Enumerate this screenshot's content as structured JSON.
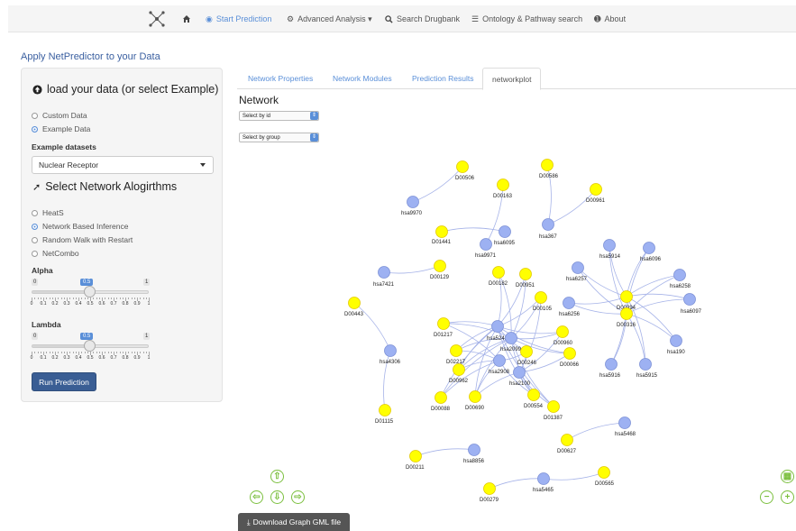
{
  "nav": {
    "items": [
      {
        "label": "",
        "icon": "network-logo-icon",
        "active": false
      },
      {
        "label": "",
        "icon": "home-icon",
        "active": false
      },
      {
        "label": "Start Prediction",
        "icon": "target-icon",
        "active": true
      },
      {
        "label": "Advanced Analysis ▾",
        "icon": "gears-icon",
        "active": false
      },
      {
        "label": "Search Drugbank",
        "icon": "search-icon",
        "active": false
      },
      {
        "label": "Ontology & Pathway search",
        "icon": "list-icon",
        "active": false
      },
      {
        "label": "About",
        "icon": "info-icon",
        "active": false
      }
    ]
  },
  "page": {
    "heading": "Apply NetPredictor to your Data"
  },
  "sidebar": {
    "load_title": "load your data (or select Example)",
    "data_options": [
      {
        "label": "Custom Data",
        "checked": false
      },
      {
        "label": "Example Data",
        "checked": true
      }
    ],
    "example_label": "Example datasets",
    "example_value": "Nuclear Receptor",
    "algo_title": "Select Network Alogirthms",
    "algo_options": [
      {
        "label": "HeatS",
        "checked": false
      },
      {
        "label": "Network Based Inference",
        "checked": true
      },
      {
        "label": "Random Walk with Restart",
        "checked": false
      },
      {
        "label": "NetCombo",
        "checked": false
      }
    ],
    "alpha": {
      "label": "Alpha",
      "min": "0",
      "max": "1",
      "value": "0.5",
      "fraction": 0.5
    },
    "lambda": {
      "label": "Lambda",
      "min": "0",
      "max": "1",
      "value": "0.5",
      "fraction": 0.5
    },
    "tick_labels": [
      "0",
      "0.1",
      "0.2",
      "0.3",
      "0.4",
      "0.5",
      "0.6",
      "0.7",
      "0.8",
      "0.9",
      "1"
    ],
    "run_label": "Run Prediction"
  },
  "tabs": [
    {
      "label": "Network Properties",
      "active": false
    },
    {
      "label": "Network Modules",
      "active": false
    },
    {
      "label": "Prediction Results",
      "active": false
    },
    {
      "label": "networkplot",
      "active": true
    }
  ],
  "network": {
    "title": "Network",
    "select_id": "Select by id",
    "select_group": "Select by group",
    "colors": {
      "drug": "#ffff00",
      "drug_stroke": "#e3c900",
      "target": "#9db1f2",
      "target_stroke": "#7d91d6",
      "edge": "#a6b3e8",
      "label": "#222222"
    },
    "download_label": "Download Graph GML file"
  }
}
